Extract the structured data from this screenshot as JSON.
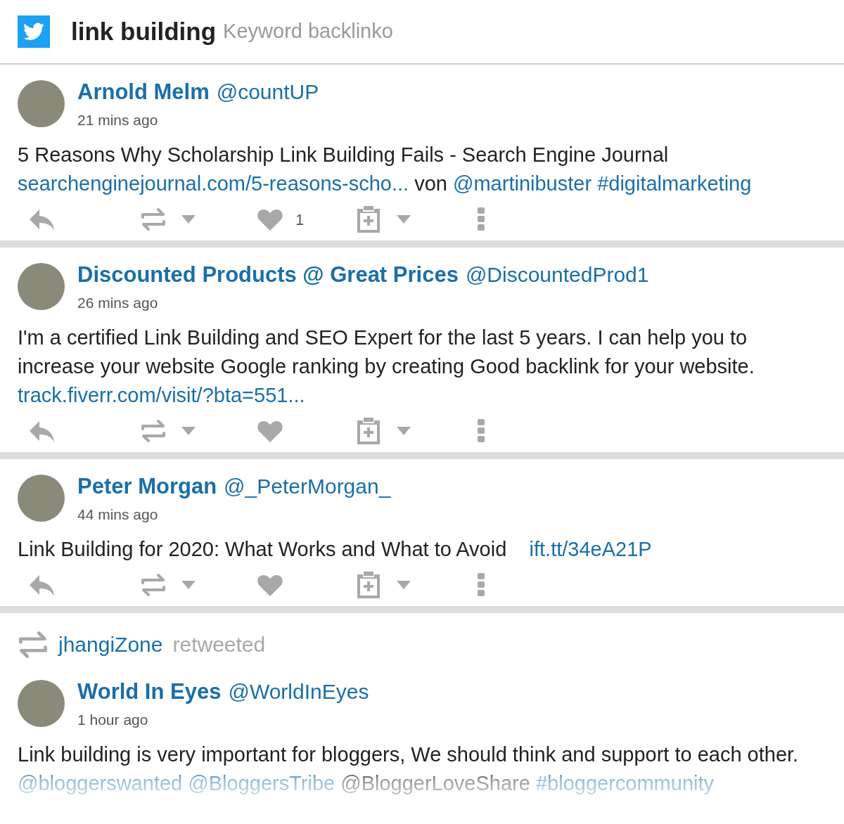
{
  "header": {
    "title": "link building",
    "subtitle": "Keyword backlinko"
  },
  "tweets": [
    {
      "name": "Arnold Melm",
      "handle": "@countUP",
      "time": "21 mins ago",
      "fade": false,
      "body": [
        {
          "kind": "text",
          "text": "5 Reasons Why Scholarship Link Building Fails - Search Engine Journal "
        },
        {
          "kind": "link",
          "text": "searchenginejournal.com/5-reasons-scho..."
        },
        {
          "kind": "text",
          "text": " von "
        },
        {
          "kind": "link",
          "text": "@martinibuster"
        },
        {
          "kind": "link",
          "text": "#digitalmarketing"
        }
      ],
      "likes": "1"
    },
    {
      "name": "Discounted Products @ Great Prices",
      "handle": "@DiscountedProd1",
      "time": "26 mins ago",
      "fade": false,
      "body": [
        {
          "kind": "text",
          "text": "I'm a certified Link Building and SEO Expert for the last 5 years. I can help you to increase your website Google ranking by creating Good backlink for your website. "
        },
        {
          "kind": "link",
          "text": "track.fiverr.com/visit/?bta=551..."
        }
      ]
    },
    {
      "name": "Peter Morgan",
      "handle": "@_PeterMorgan_",
      "time": "44 mins ago",
      "fade": false,
      "body": [
        {
          "kind": "text",
          "text": "Link Building for 2020: What Works and What to Avoid    "
        },
        {
          "kind": "link",
          "text": "ift.tt/34eA21P"
        }
      ]
    },
    {
      "retweeted_by": {
        "name": "jhangiZone",
        "label": "retweeted"
      },
      "name": "World In Eyes",
      "handle": "@WorldInEyes",
      "time": "1 hour ago",
      "fade": true,
      "body": [
        {
          "kind": "text",
          "text": "Link building is very important for bloggers, We should think and support to each other. "
        },
        {
          "kind": "link",
          "text": "@bloggerswanted"
        },
        {
          "kind": "link",
          "text": "@BloggersTribe"
        },
        {
          "kind": "text",
          "text": " @BloggerLoveShare "
        },
        {
          "kind": "link",
          "text": "#bloggercommunity"
        }
      ]
    }
  ]
}
